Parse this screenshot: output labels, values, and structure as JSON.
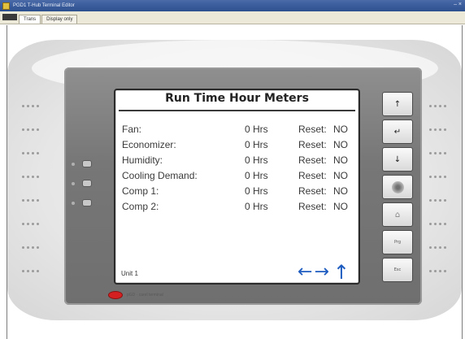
{
  "window": {
    "title": "PGD1 T-Hub Terminal Editor",
    "controls": "– ×"
  },
  "menubar": {
    "tabs": [
      {
        "label": "Trans"
      },
      {
        "label": "Display only"
      }
    ]
  },
  "screen": {
    "title": "Run Time Hour Meters",
    "rows": [
      {
        "label": "Fan:",
        "value": "0 Hrs",
        "reset": "Reset:",
        "state": "NO"
      },
      {
        "label": "Economizer:",
        "value": "0 Hrs",
        "reset": "Reset:",
        "state": "NO"
      },
      {
        "label": "Humidity:",
        "value": "0 Hrs",
        "reset": "Reset:",
        "state": "NO"
      },
      {
        "label": "Cooling Demand:",
        "value": "0 Hrs",
        "reset": "Reset:",
        "state": "NO"
      },
      {
        "label": "Comp 1:",
        "value": "0 Hrs",
        "reset": "Reset:",
        "state": "NO"
      },
      {
        "label": "Comp 2:",
        "value": "0 Hrs",
        "reset": "Reset:",
        "state": "NO"
      }
    ],
    "unit": "Unit 1",
    "nav": {
      "left": "←",
      "right": "→",
      "up": "↑"
    }
  },
  "keys": {
    "up": "↑",
    "enter": "↵",
    "down": "↓",
    "home": "⌂",
    "prg": "Prg",
    "esc": "Esc"
  },
  "footer": {
    "logo_text": "pGD · carel terminal"
  },
  "colors": {
    "nav_arrows": "#1e5cc0",
    "logo": "#d42020",
    "titlebar": "#2c4f8e"
  }
}
